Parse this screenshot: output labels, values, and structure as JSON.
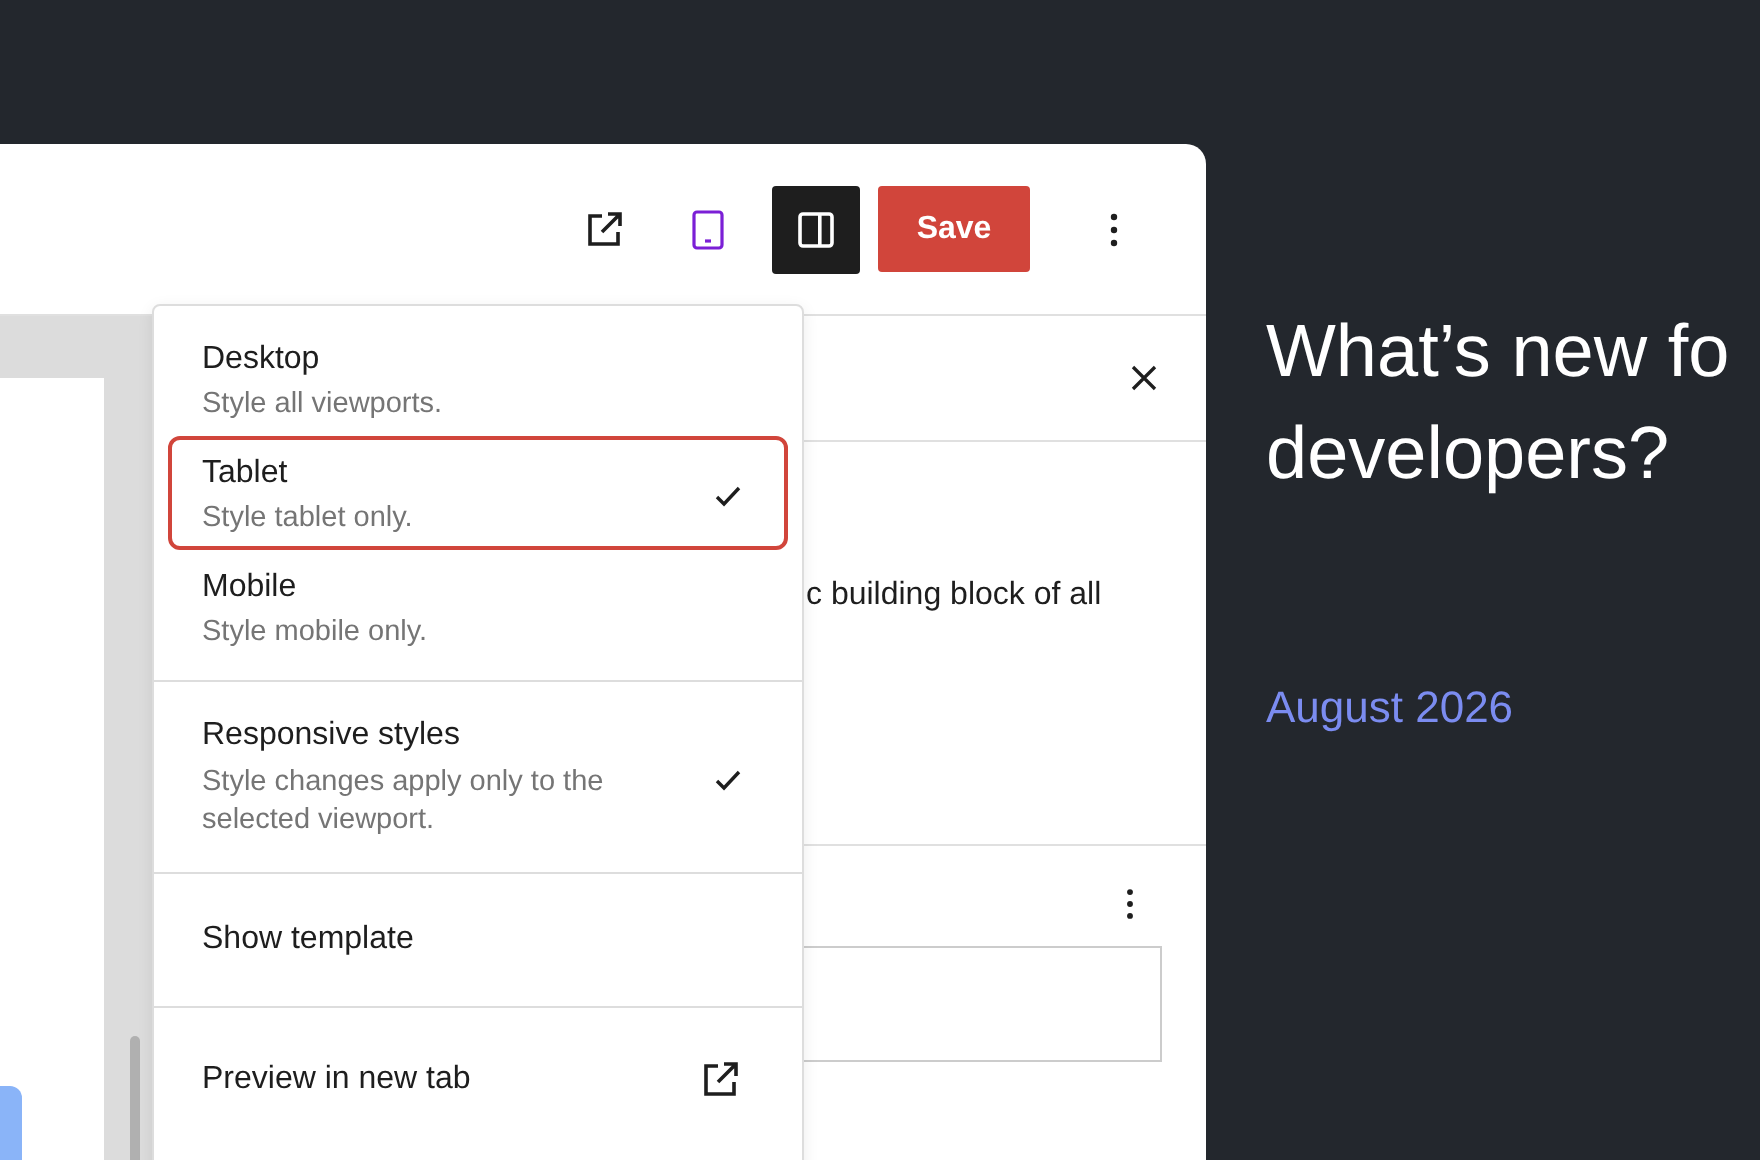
{
  "toolbar": {
    "settings_pressed": true,
    "save_label": "Save"
  },
  "menu": {
    "sections": [
      {
        "items": [
          {
            "kind": "viewport",
            "label": "Desktop",
            "description": "Style all viewports.",
            "selected": false
          },
          {
            "kind": "viewport",
            "label": "Tablet",
            "description": "Style tablet only.",
            "selected": true
          },
          {
            "kind": "viewport",
            "label": "Mobile",
            "description": "Style mobile only.",
            "selected": false
          }
        ]
      },
      {
        "items": [
          {
            "kind": "toggle",
            "label": "Responsive styles",
            "description": "Style changes apply only to the selected viewport.",
            "checked": true
          }
        ]
      },
      {
        "items": [
          {
            "kind": "action",
            "label": "Show template"
          }
        ]
      },
      {
        "items": [
          {
            "kind": "link",
            "label": "Preview in new tab"
          }
        ]
      }
    ]
  },
  "sidebar": {
    "text": "c building block of all"
  },
  "promo": {
    "title": "What’s new fo developers?",
    "date": "August 2026"
  }
}
